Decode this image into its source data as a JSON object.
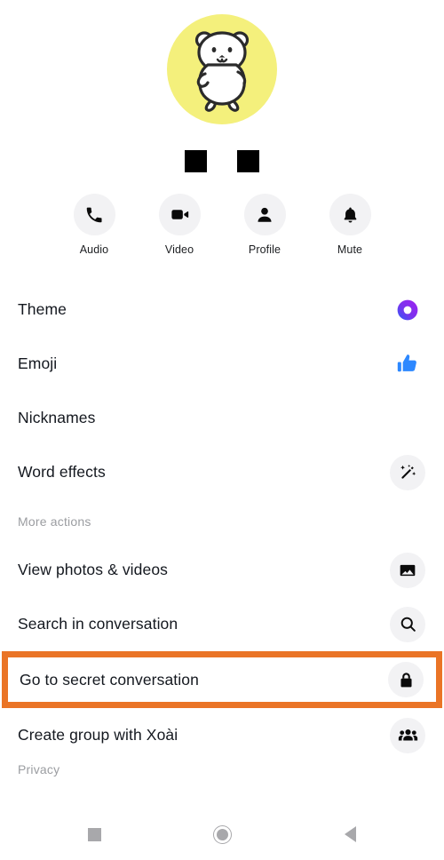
{
  "avatar": {
    "icon": "white-bear-cartoon-avatar",
    "background_color": "#f4f07c"
  },
  "contact_name_redacted": {
    "icon": "redaction-block",
    "blocks": 2
  },
  "quick_actions": [
    {
      "label": "Audio",
      "icon": "phone-icon"
    },
    {
      "label": "Video",
      "icon": "video-camera-icon"
    },
    {
      "label": "Profile",
      "icon": "person-icon"
    },
    {
      "label": "Mute",
      "icon": "bell-icon"
    }
  ],
  "menu": {
    "items": [
      {
        "label": "Theme",
        "icon": "theme-ring-icon",
        "type": "row",
        "highlighted": false
      },
      {
        "label": "Emoji",
        "icon": "thumbs-up-icon",
        "type": "row",
        "highlighted": false
      },
      {
        "label": "Nicknames",
        "icon": "none",
        "type": "row",
        "highlighted": false
      },
      {
        "label": "Word effects",
        "icon": "magic-wand-icon",
        "type": "row",
        "highlighted": false
      },
      {
        "label": "More actions",
        "icon": "none",
        "type": "section",
        "highlighted": false
      },
      {
        "label": "View photos & videos",
        "icon": "image-icon",
        "type": "row",
        "highlighted": false
      },
      {
        "label": "Search in conversation",
        "icon": "search-icon",
        "type": "row",
        "highlighted": false
      },
      {
        "label": "Go to secret conversation",
        "icon": "lock-icon",
        "type": "row",
        "highlighted": true
      },
      {
        "label": "Create group with Xoài",
        "icon": "group-people-icon",
        "type": "row",
        "highlighted": false
      },
      {
        "label": "Privacy",
        "icon": "none",
        "type": "section",
        "highlighted": false
      }
    ]
  },
  "highlight": {
    "color": "#ea7426",
    "target": "Go to secret conversation"
  },
  "navbar": {
    "buttons": [
      {
        "name": "recents",
        "icon": "square-icon"
      },
      {
        "name": "home",
        "icon": "circle-icon"
      },
      {
        "name": "back",
        "icon": "triangle-back-icon"
      }
    ]
  },
  "colors": {
    "accent_highlight": "#ea7426",
    "emoji_blue": "#2d88ff",
    "theme_purple": "#8a2be2",
    "theme_blue": "#3b5cf5",
    "icon_bg": "#f2f2f4",
    "text_primary": "#14181f",
    "text_muted": "#9b9da1"
  }
}
